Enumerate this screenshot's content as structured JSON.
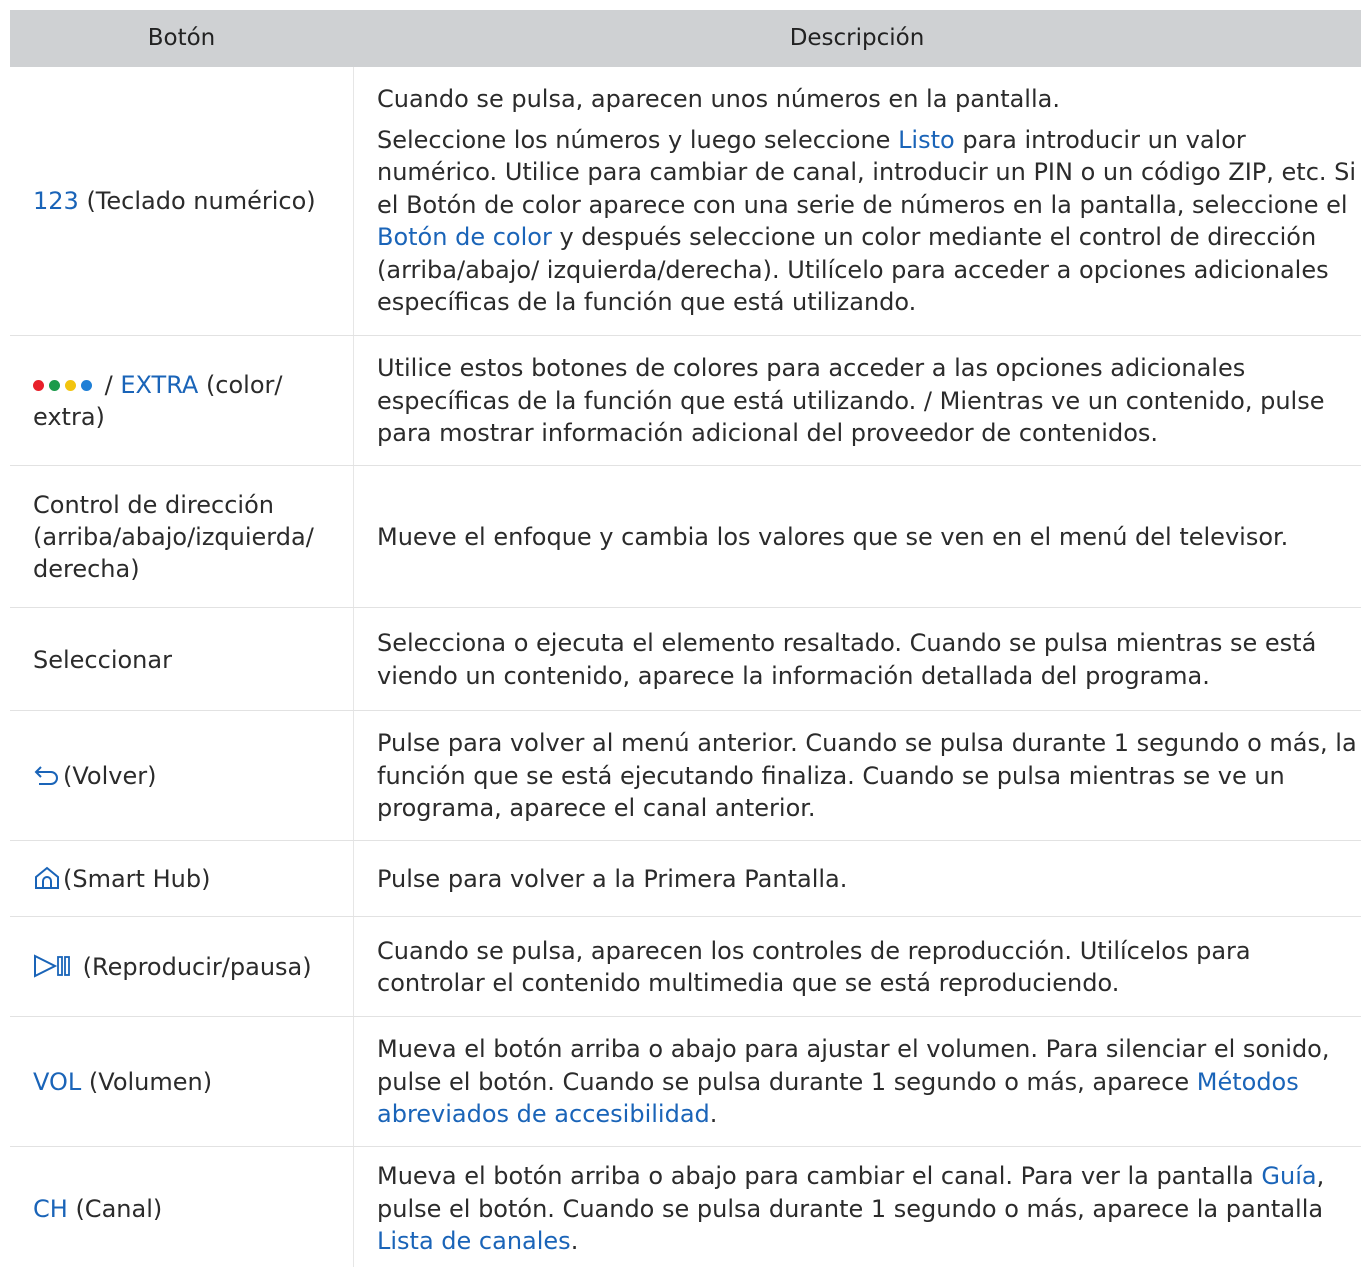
{
  "header": {
    "col_button": "Botón",
    "col_description": "Descripción"
  },
  "colors": {
    "link": "#1a64b8",
    "header_bg": "#cfd1d3",
    "dot_red": "#e8202a",
    "dot_green": "#1a9a4a",
    "dot_yellow": "#f2c40f",
    "dot_blue": "#1e7fd6"
  },
  "rows": [
    {
      "btn_hl": "123",
      "btn_text": " (Teclado numérico)",
      "desc1": "Cuando se pulsa, aparecen unos números en la pantalla.",
      "d2a": "Seleccione los números y luego seleccione ",
      "d2b": "Listo",
      "d2c": " para introducir un valor numérico. Utilice para cambiar de canal, introducir un PIN o un código ZIP, etc. Si el Botón de color aparece con una serie de números en la pantalla, seleccione el ",
      "d2d": "Botón de color",
      "d2e": " y después seleccione un color mediante el control de dirección (arriba/abajo/ izquierda/derecha). Utilícelo para acceder a opciones adicionales específicas de la función que está utilizando."
    },
    {
      "btn_sep": " / ",
      "btn_hl": "EXTRA",
      "btn_text": " (color/ extra)",
      "desc": "Utilice estos botones de colores para acceder a las opciones adicionales específicas de la función que está utilizando. / Mientras ve un contenido, pulse para mostrar información adicional del proveedor de contenidos."
    },
    {
      "btn_text": "Control de dirección (arriba/abajo/izquierda/ derecha)",
      "desc": "Mueve el enfoque y cambia los valores que se ven en el menú del televisor."
    },
    {
      "btn_text": "Seleccionar",
      "desc": "Selecciona o ejecuta el elemento resaltado. Cuando se pulsa mientras se está viendo un contenido, aparece la información detallada del programa."
    },
    {
      "icon": "return-arrow-icon",
      "btn_text": "(Volver)",
      "desc": "Pulse para volver al menú anterior. Cuando se pulsa durante 1 segundo o más, la función que se está ejecutando finaliza. Cuando se pulsa mientras se ve un programa, aparece el canal anterior."
    },
    {
      "icon": "home-icon",
      "btn_text": "(Smart Hub)",
      "desc": "Pulse para volver a la Primera Pantalla."
    },
    {
      "icon": "play-pause-icon",
      "btn_text": " (Reproducir/pausa)",
      "desc": "Cuando se pulsa, aparecen los controles de reproducción. Utilícelos para controlar el contenido multimedia que se está reproduciendo."
    },
    {
      "btn_hl": "VOL",
      "btn_text": " (Volumen)",
      "da": "Mueva el botón arriba o abajo para ajustar el volumen. Para silenciar el sonido, pulse el botón. Cuando se pulsa durante 1 segundo o más, aparece ",
      "db": "Métodos abreviados de accesibilidad",
      "dc": "."
    },
    {
      "btn_hl": "CH",
      "btn_text": " (Canal)",
      "da": "Mueva el botón arriba o abajo para cambiar el canal. Para ver la pantalla ",
      "db": "Guía",
      "dc": ", pulse el botón. Cuando se pulsa durante 1 segundo o más, aparece la pantalla ",
      "dd": "Lista de canales",
      "de": "."
    }
  ]
}
